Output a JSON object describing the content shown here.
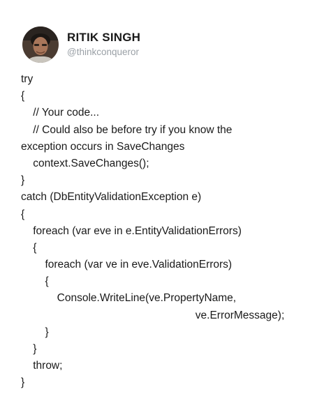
{
  "author": {
    "name": "RITIK SINGH",
    "handle": "@thinkconqueror",
    "avatar_icon": "profile-photo"
  },
  "code_lines": [
    "try",
    "{",
    "    // Your code...",
    "    // Could also be before try if you know the",
    "exception occurs in SaveChanges",
    "    context.SaveChanges();",
    "}",
    "catch (DbEntityValidationException e)",
    "{",
    "    foreach (var eve in e.EntityValidationErrors)",
    "    {",
    "        foreach (var ve in eve.ValidationErrors)",
    "        {",
    "            Console.WriteLine(ve.PropertyName,",
    "                                                          ve.ErrorMessage);",
    "        }",
    "    }",
    "    throw;",
    "}"
  ]
}
